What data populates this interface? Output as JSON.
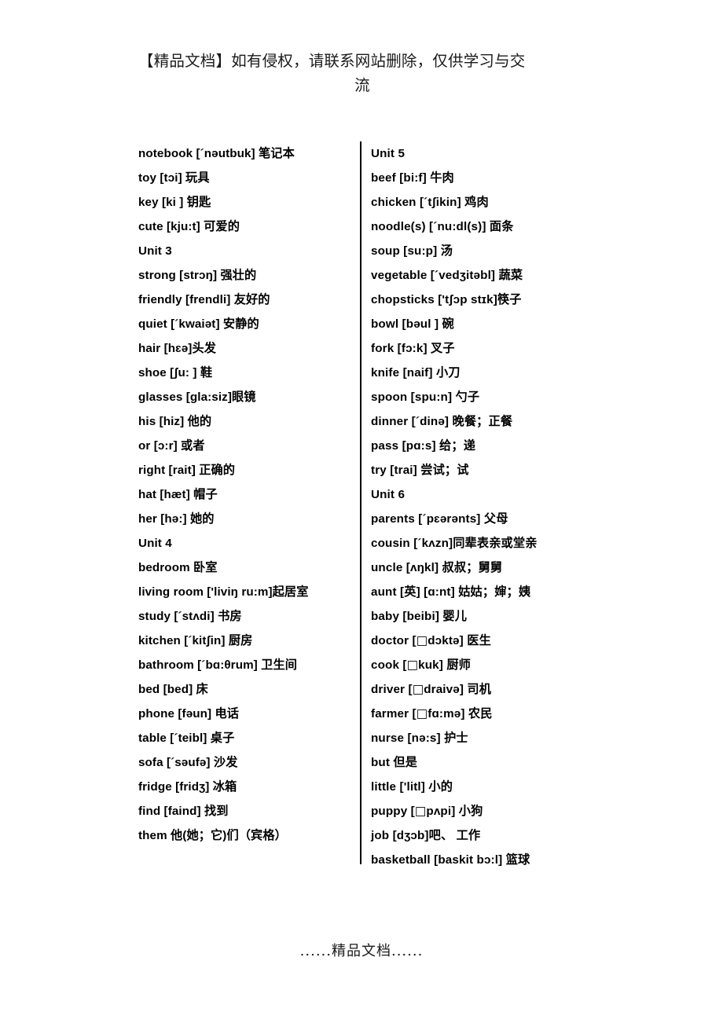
{
  "header": {
    "line1": "【精品文档】如有侵权，请联系网站删除，仅供学习与交",
    "line2": "流"
  },
  "footer": {
    "text": "......精品文档......"
  },
  "columns": {
    "left": [
      {
        "text": "notebook [´nəutbuk] 笔记本"
      },
      {
        "text": "toy [tɔi]  玩具"
      },
      {
        "text": "key     [ki ]   钥匙"
      },
      {
        "text": "cute    [kju:t]   可爱的"
      },
      {
        "text": "Unit 3"
      },
      {
        "text": "strong [strɔŋ] 强壮的"
      },
      {
        "text": "friendly [frendli] 友好的"
      },
      {
        "text": "quiet [´kwaiət] 安静的"
      },
      {
        "text": "hair [hɛə]头发"
      },
      {
        "text": "shoe    [ʃu: ]    鞋"
      },
      {
        "text": "glasses    [gla:siz]眼镜"
      },
      {
        "text": "his   [hiz]   他的"
      },
      {
        "text": "or   [ɔ:r]   或者"
      },
      {
        "text": "right   [rait] 正确的"
      },
      {
        "text": "hat   [hæt]   帽子"
      },
      {
        "text": "her [hə:] 她的"
      },
      {
        "text": "Unit 4"
      },
      {
        "text": "bedroom  卧室"
      },
      {
        "text": "living room ['liviŋ ru:m]起居室"
      },
      {
        "text": "study [´stʌdi] 书房"
      },
      {
        "text": "kitchen [´kitʃin] 厨房"
      },
      {
        "text": "bathroom   [´bɑ:θrum]   卫生间",
        "wrap": true
      },
      {
        "text": "bed   [bed]     床"
      },
      {
        "text": "phone [fəun]   电话"
      },
      {
        "text": "table   [´teibl]   桌子"
      },
      {
        "text": "sofa   [´səufə]   沙发"
      },
      {
        "text": "fridge   [fridʒ]   冰箱"
      },
      {
        "text": "find   [faind]    找到"
      },
      {
        "text": "them 他(她；它)们（宾格）"
      }
    ],
    "right": [
      {
        "text": "Unit 5"
      },
      {
        "text": "beef   [bi:f] 牛肉"
      },
      {
        "text": "chicken   [´tʃikin] 鸡肉"
      },
      {
        "text": "noodle(s) [´nu:dl(s)] 面条"
      },
      {
        "text": "soup [su:p] 汤"
      },
      {
        "text": "vegetable [´vedʒitəbl] 蔬菜"
      },
      {
        "text": "chopsticks ['tʃɔp stɪk]筷子"
      },
      {
        "text": "bowl   [bəul ]    碗"
      },
      {
        "text": "fork [fɔ:k] 叉子"
      },
      {
        "text": "knife [naif] 小刀"
      },
      {
        "text": "spoon [spu:n] 勺子"
      },
      {
        "text": "dinner [´dinə] 晚餐；正餐"
      },
      {
        "text": "pass [pɑ:s] 给；递"
      },
      {
        "text": "try [trai] 尝试；试"
      },
      {
        "text": "Unit 6"
      },
      {
        "text": "parents [´pɛərənts] 父母"
      },
      {
        "text": "cousin [´kʌzn]同辈表亲或堂亲"
      },
      {
        "text": "uncle [ʌŋkl] 叔叔；",
        "heavy_suffix": "舅舅"
      },
      {
        "text": "aunt   [英] [ɑ:nt] 姑姑；婶；姨"
      },
      {
        "text": "baby [beibi] 婴儿"
      },
      {
        "text": "doctor [",
        "tofu": "□",
        "text2": "dɔktə] 医生"
      },
      {
        "text": "cook   [",
        "tofu": "□",
        "text2": "kuk]   厨师"
      },
      {
        "text": "driver [",
        "tofu": "□",
        "text2": "draivə] 司机"
      },
      {
        "text": "farmer [",
        "tofu": "□",
        "text2": "fɑ:mə] 农民"
      },
      {
        "text": "nurse [nə:s] 护士"
      },
      {
        "text": "but     但是"
      },
      {
        "text": "little   ['litl]   小的"
      },
      {
        "text": "puppy [",
        "tofu": "□",
        "text2": "pʌpi] 小狗"
      },
      {
        "text": "job   [dʒɔb]吧、 工作"
      },
      {
        "text": "basketball [baskit bɔ:l] 篮球"
      }
    ]
  }
}
